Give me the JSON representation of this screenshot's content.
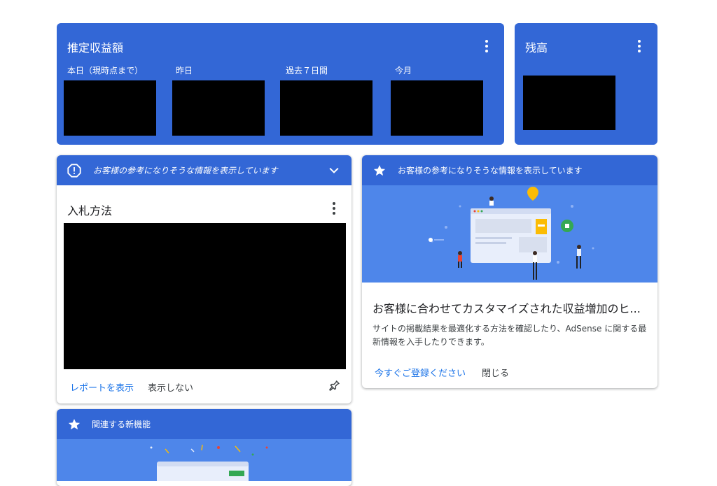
{
  "earnings": {
    "title": "推定収益額",
    "periods": [
      "本日（現時点まで）",
      "昨日",
      "過去７日間",
      "今月"
    ]
  },
  "balance": {
    "title": "残高"
  },
  "bidding_card": {
    "header": "お客様の参考になりそうな情報を表示しています",
    "title": "入札方法",
    "view_report": "レポートを表示",
    "hide": "表示しない"
  },
  "promo_card": {
    "header": "お客様の参考になりそうな情報を表示しています",
    "title": "お客様に合わせてカスタマイズされた収益増加のヒ...",
    "body": "サイトの掲載結果を最適化する方法を確認したり、AdSense に関する最新情報を入手したりできます。",
    "signup": "今すぐご登録ください",
    "close": "閉じる"
  },
  "new_features_card": {
    "header": "関連する新機能"
  },
  "icons": [
    "more-vert-icon",
    "alert-icon",
    "chevron-down-icon",
    "star-icon",
    "pin-icon"
  ],
  "colors": {
    "brand_blue": "#3367d6",
    "illustration_blue": "#4e86ea",
    "link_blue": "#1a73e8"
  }
}
